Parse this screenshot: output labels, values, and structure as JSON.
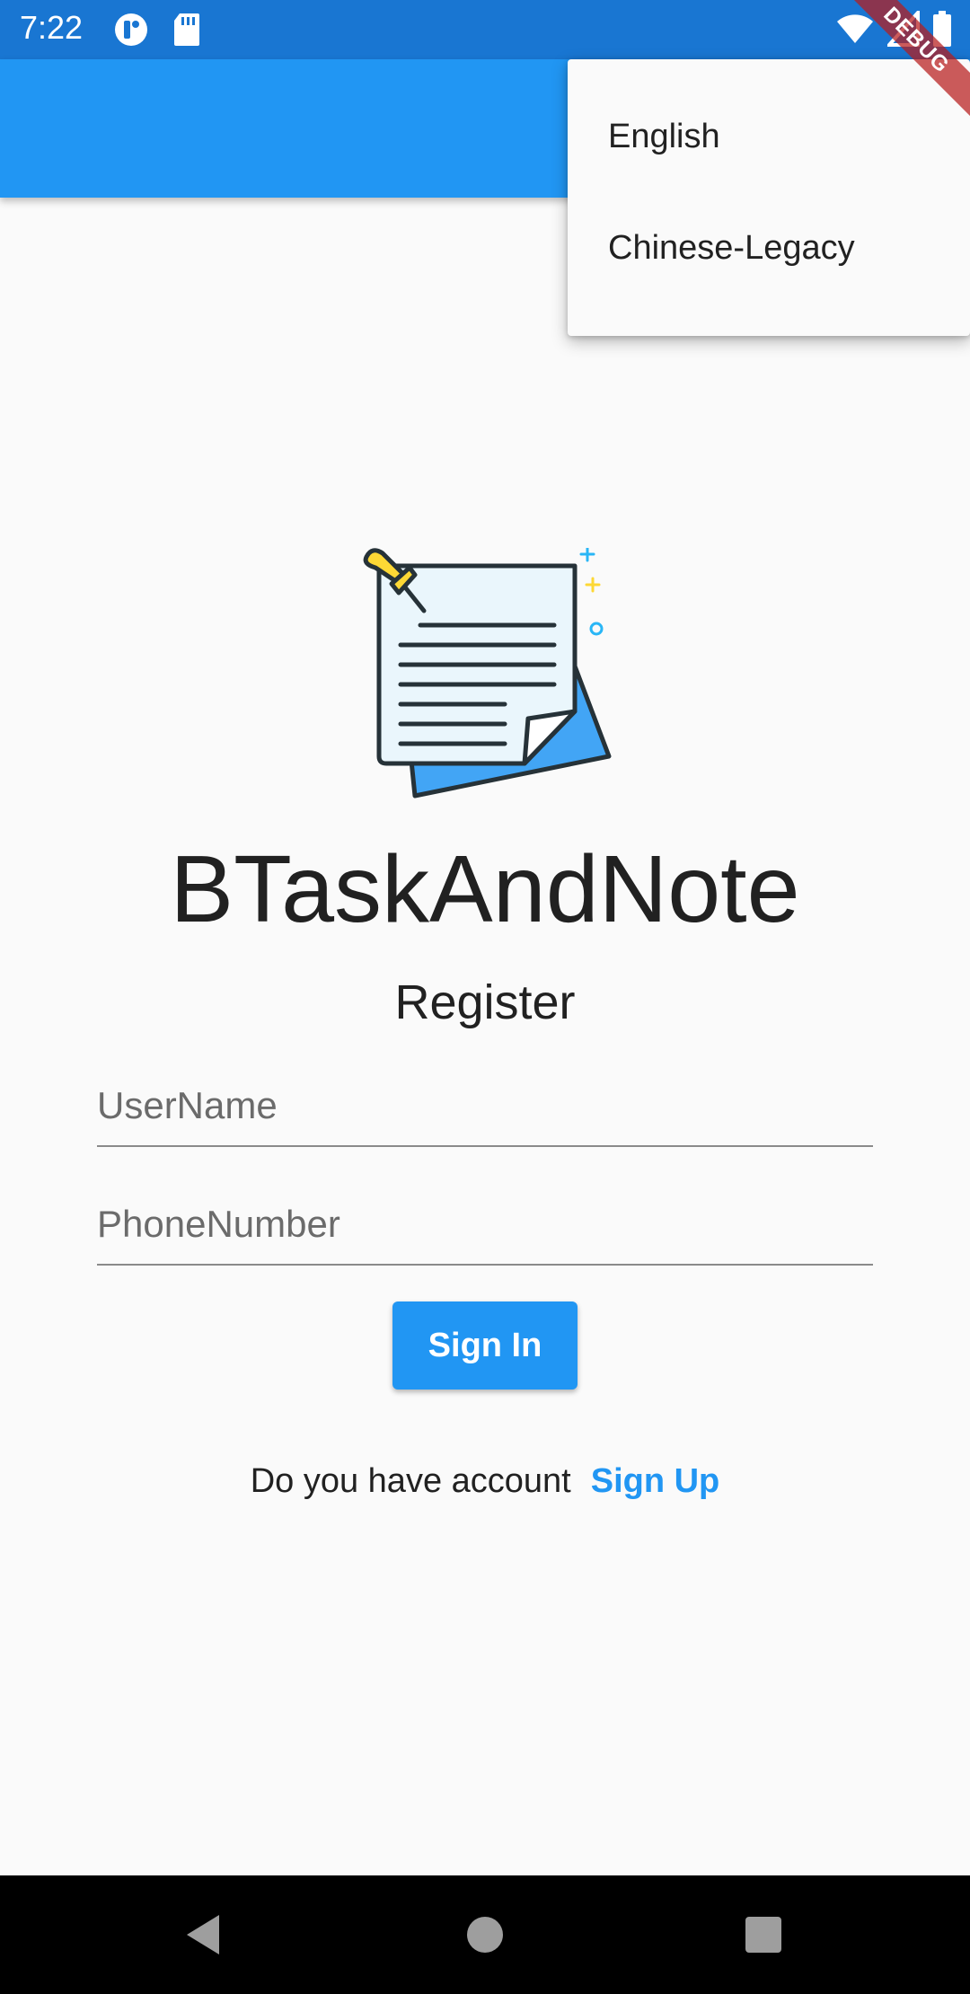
{
  "status_bar": {
    "time": "7:22",
    "icons": [
      "app-notification-icon",
      "sd-card-icon",
      "wifi-icon",
      "signal-icon",
      "battery-icon"
    ]
  },
  "debug_banner": "DEBUG",
  "language_menu": {
    "items": [
      {
        "label": "English"
      },
      {
        "label": "Chinese-Legacy"
      }
    ]
  },
  "app": {
    "title": "BTaskAndNote",
    "subtitle": "Register"
  },
  "form": {
    "username_placeholder": "UserName",
    "username_value": "",
    "phone_placeholder": "PhoneNumber",
    "phone_value": "",
    "signin_label": "Sign In"
  },
  "footer": {
    "prompt": "Do you have account",
    "signup_label": "Sign Up"
  },
  "colors": {
    "primary": "#2196F3",
    "status_bar": "#1976D2",
    "background": "#FAFAFA",
    "debug": "#B71C1C"
  },
  "nav_bar": {
    "icons": [
      "back-icon",
      "home-icon",
      "recents-icon"
    ]
  }
}
